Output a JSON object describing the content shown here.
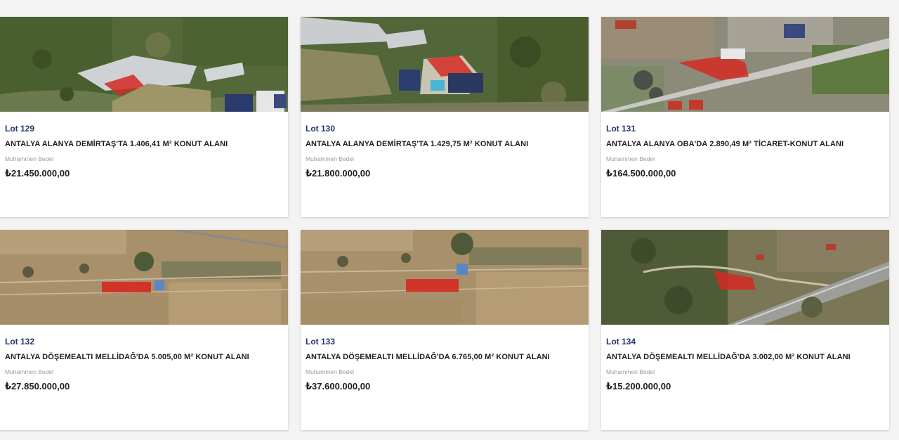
{
  "lots": [
    {
      "lot": "Lot 129",
      "title": "ANTALYA ALANYA DEMİRTAŞ'TA 1.406,41 M² KONUT ALANI",
      "label": "Muhammen Bedel",
      "price": "₺21.450.000,00",
      "image": "satellite-green-greenhouses"
    },
    {
      "lot": "Lot 130",
      "title": "ANTALYA ALANYA DEMİRTAŞ'TA 1.429,75 M² KONUT ALANI",
      "label": "Muhammen Bedel",
      "price": "₺21.800.000,00",
      "image": "satellite-green-greenhouses"
    },
    {
      "lot": "Lot 131",
      "title": "ANTALYA ALANYA OBA'DA 2.890,49 M² TİCARET-KONUT ALANI",
      "label": "Muhammen Bedel",
      "price": "₺164.500.000,00",
      "image": "satellite-urban-road"
    },
    {
      "lot": "Lot 132",
      "title": "ANTALYA DÖŞEMEALTI MELLİDAĞ'DA 5.005,00 M² KONUT ALANI",
      "label": "Muhammen Bedel",
      "price": "₺27.850.000,00",
      "image": "satellite-farmland"
    },
    {
      "lot": "Lot 133",
      "title": "ANTALYA DÖŞEMEALTI MELLİDAĞ'DA 6.765,00 M² KONUT ALANI",
      "label": "Muhammen Bedel",
      "price": "₺37.600.000,00",
      "image": "satellite-farmland"
    },
    {
      "lot": "Lot 134",
      "title": "ANTALYA DÖŞEMEALTI MELLİDAĞ'DA 3.002,00 M² KONUT ALANI",
      "label": "Muhammen Bedel",
      "price": "₺15.200.000,00",
      "image": "satellite-highway"
    }
  ],
  "colors": {
    "lot_link": "#23356b",
    "parcel_highlight": "#d9251f",
    "card_bg": "#ffffff",
    "page_bg": "#f3f3f3"
  }
}
